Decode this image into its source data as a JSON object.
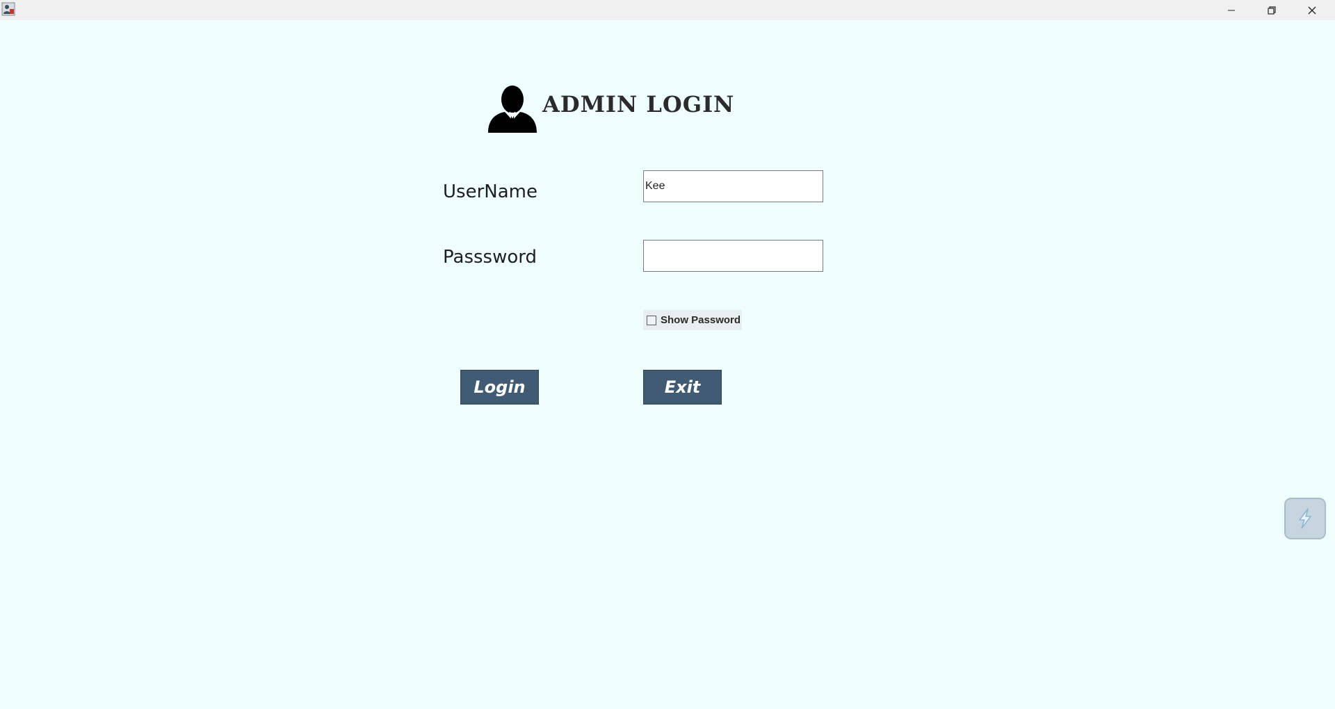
{
  "window": {
    "minimize_icon": "minimize-icon",
    "maximize_icon": "restore-icon",
    "close_icon": "close-icon"
  },
  "form": {
    "title": "ADMIN LOGIN",
    "admin_icon": "admin-user-icon",
    "username_label": "UserName",
    "username_value": "Kee",
    "password_label": "Passsword",
    "password_value": "",
    "show_password_label": "Show Password",
    "show_password_checked": false,
    "login_label": "Login",
    "exit_label": "Exit"
  },
  "colors": {
    "background": "#effffe",
    "button": "#415b72",
    "button_text": "#ffffff"
  }
}
